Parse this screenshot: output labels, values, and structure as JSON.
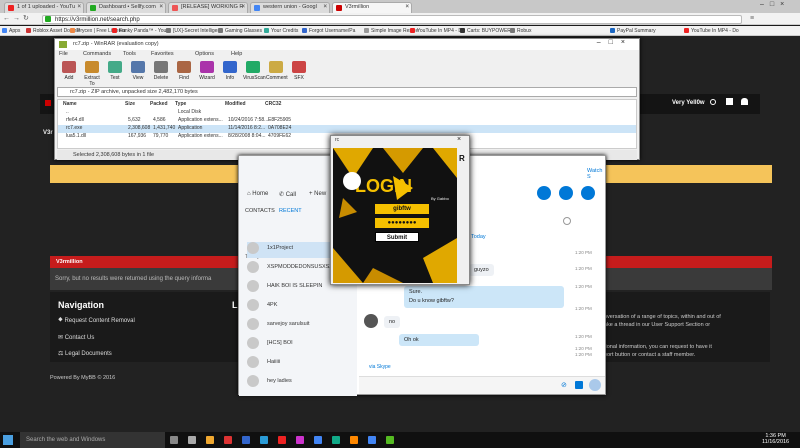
{
  "browser": {
    "tabs": [
      {
        "label": "1 of 1 uploaded - YouTu",
        "color": "#e22"
      },
      {
        "label": "Dashboard • Sellfy.com",
        "color": "#2a2"
      },
      {
        "label": "[RELEASE] WORKING R",
        "color": "#e55"
      },
      {
        "label": "western union - Googl",
        "color": "#4285f4"
      },
      {
        "label": "V3rmillion",
        "color": "#c00"
      }
    ],
    "url": "https://v3rmillion.net/search.php",
    "bookmarks": [
      "Apps",
      "Roblox Asset Downlo",
      "Prycex | Free Listenin",
      "Funky Panda™ - YouT",
      "[UX]-Secret Intelligen",
      "Gaming Glasses",
      "Your Credits",
      "Forgot Username/Pa",
      "Simple Image Resize",
      "YouTube In MP4 - Do",
      "Carts: BUYPOWER f",
      "Robux",
      "PayPal Summary",
      "YouTube In MP4 - Do"
    ]
  },
  "site": {
    "user": "Very Yell0w",
    "notice_section": "V3rmillion",
    "no_results": "Sorry, but no results were returned using the query informa",
    "nav_title": "Navigation",
    "nav_items": [
      "Request Content Removal",
      "Contact Us",
      "Legal Documents"
    ],
    "right_text_1": "nversation of a range of topics, within and out of",
    "right_text_2": "ake a thread in our User Support Section or",
    "right_text_3": "tional information, you can request to have it",
    "right_text_4": "port button or contact a staff member.",
    "powered": "Powered By MyBB © 2016"
  },
  "winrar": {
    "title": "rc7.zip - WinRAR (evaluation copy)",
    "menu": [
      "File",
      "Commands",
      "Tools",
      "Favorites",
      "Options",
      "Help"
    ],
    "tools": [
      {
        "label": "Add",
        "color": "#b55"
      },
      {
        "label": "Extract To",
        "color": "#c88a2c"
      },
      {
        "label": "Test",
        "color": "#4a8"
      },
      {
        "label": "View",
        "color": "#57a"
      },
      {
        "label": "Delete",
        "color": "#777"
      },
      {
        "label": "Find",
        "color": "#a64"
      },
      {
        "label": "Wizard",
        "color": "#a3a"
      },
      {
        "label": "Info",
        "color": "#36c"
      },
      {
        "label": "VirusScan",
        "color": "#2a6"
      },
      {
        "label": "Comment",
        "color": "#ca4"
      },
      {
        "label": "SFX",
        "color": "#c44"
      }
    ],
    "path": "rc7.zip - ZIP archive, unpacked size 2,482,170 bytes",
    "headers": [
      "Name",
      "Size",
      "Packed",
      "Type",
      "Modified",
      "CRC32"
    ],
    "rows": [
      [
        "..",
        "",
        "",
        "Local Disk",
        "",
        ""
      ],
      [
        "rfe64.dll",
        "5,632",
        "4,586",
        "Application extens...",
        "10/24/2016 7:58...",
        "E8F25905"
      ],
      [
        "rc7.exe",
        "2,308,608",
        "1,431,740",
        "Application",
        "11/14/2016 8:2...",
        "0A708E24"
      ],
      [
        "lua5.1.dll",
        "167,936",
        "79,770",
        "Application extens...",
        "8/28/2008 8:04...",
        "4709FE62"
      ]
    ],
    "status": "Selected 2,308,608 bytes in 1 file"
  },
  "skype": {
    "nav": [
      "Home",
      "Call",
      "New"
    ],
    "tabs": [
      "CONTACTS",
      "RECENT"
    ],
    "today": "Today",
    "contacts": [
      "1x1Project",
      "XSPMODDEDONSUSXS2018",
      "HAIK BOI IS SLEEPIN",
      "4PK",
      "sarvejoy sarulsuit",
      "[HCS] BOI",
      "Haiiiii",
      "hey ladies"
    ],
    "watch": "Watch S",
    "messages": [
      {
        "text": "guyzo",
        "time": ""
      },
      {
        "text": "Sure.",
        "time": "1:20 PM"
      },
      {
        "text": "Do u know gibftw?",
        "time": ""
      },
      {
        "text": "no",
        "time": "1:20 PM"
      },
      {
        "text": "Oh ok",
        "time": "1:20 PM"
      }
    ],
    "times": [
      "1:20 PM",
      "1:20 PM",
      "1:20 PM",
      "1:20 PM",
      "1:20 PM",
      "1:20 PM",
      "1:20 PM"
    ],
    "via": "via Skype"
  },
  "login": {
    "title": "LOGIN",
    "by": "By Gabbo",
    "username": "gibftw",
    "password": "●●●●●●●●",
    "submit": "Submit",
    "win_title": "rc"
  },
  "taskbar": {
    "search": "Search the web and Windows",
    "time": "1:36 PM",
    "date": "11/16/2016"
  }
}
